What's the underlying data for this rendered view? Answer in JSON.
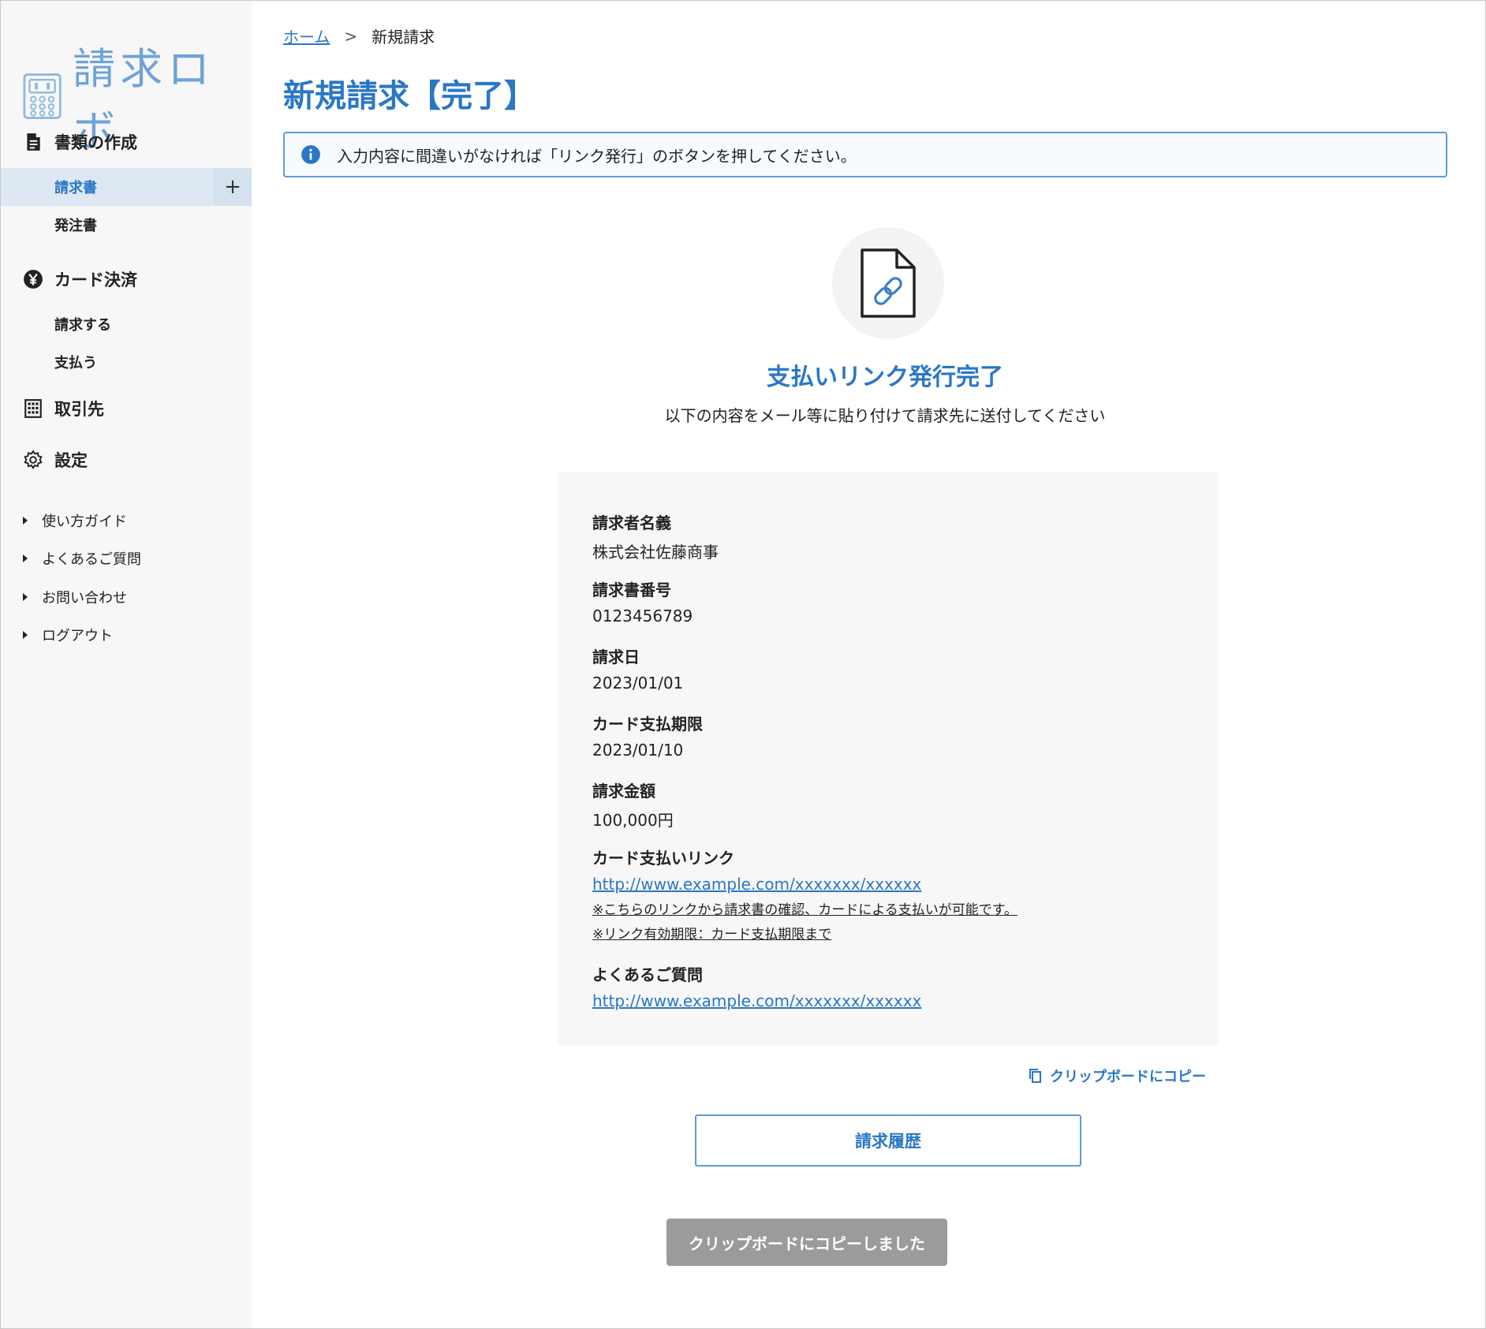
{
  "app": {
    "logo_text": "請求ロボ"
  },
  "sidebar": {
    "sections": [
      {
        "label": "書類の作成",
        "icon": "document-icon"
      },
      {
        "label": "カード決済",
        "icon": "yen-icon"
      },
      {
        "label": "取引先",
        "icon": "building-icon"
      },
      {
        "label": "設定",
        "icon": "gear-icon"
      }
    ],
    "doc_items": [
      {
        "label": "請求書",
        "plus": "+"
      },
      {
        "label": "発注書"
      }
    ],
    "card_items": [
      {
        "label": "請求する"
      },
      {
        "label": "支払う"
      }
    ],
    "links": [
      {
        "label": "使い方ガイド"
      },
      {
        "label": "よくあるご質問"
      },
      {
        "label": "お問い合わせ"
      },
      {
        "label": "ログアウト"
      }
    ]
  },
  "breadcrumb": {
    "home": "ホーム",
    "separator": ">",
    "current": "新規請求"
  },
  "page": {
    "title": "新規請求【完了】",
    "alert": "入力内容に間違いがなければ「リンク発行」のボタンを押してください。",
    "complete_title": "支払いリンク発行完了",
    "complete_sub": "以下の内容をメール等に貼り付けて請求先に送付してください"
  },
  "details": {
    "requester_label": "請求者名義",
    "requester_value": "株式会社佐藤商事",
    "invoice_no_label": "請求書番号",
    "invoice_no_value": "0123456789",
    "date_label": "請求日",
    "date_value": "2023/01/01",
    "due_label": "カード支払期限",
    "due_value": "2023/01/10",
    "amount_label": "請求金額",
    "amount_value": "100,000円",
    "pay_link_label": "カード支払いリンク",
    "pay_link_value": "http://www.example.com/xxxxxxx/xxxxxx",
    "pay_note_1": "※こちらのリンクから請求書の確認、カードによる支払いが可能です。",
    "pay_note_2": "※リンク有効期限：カード支払期限まで",
    "faq_label": "よくあるご質問",
    "faq_value": "http://www.example.com/xxxxxxx/xxxxxx"
  },
  "actions": {
    "copy_label": "クリップボードにコピー",
    "history_button": "請求履歴",
    "toast": "クリップボードにコピーしました"
  },
  "colors": {
    "accent": "#2a77c6",
    "sidebar_bg": "#f7f7f7",
    "active_bg": "#dde8f3",
    "toast_bg": "#9b9b9b"
  }
}
